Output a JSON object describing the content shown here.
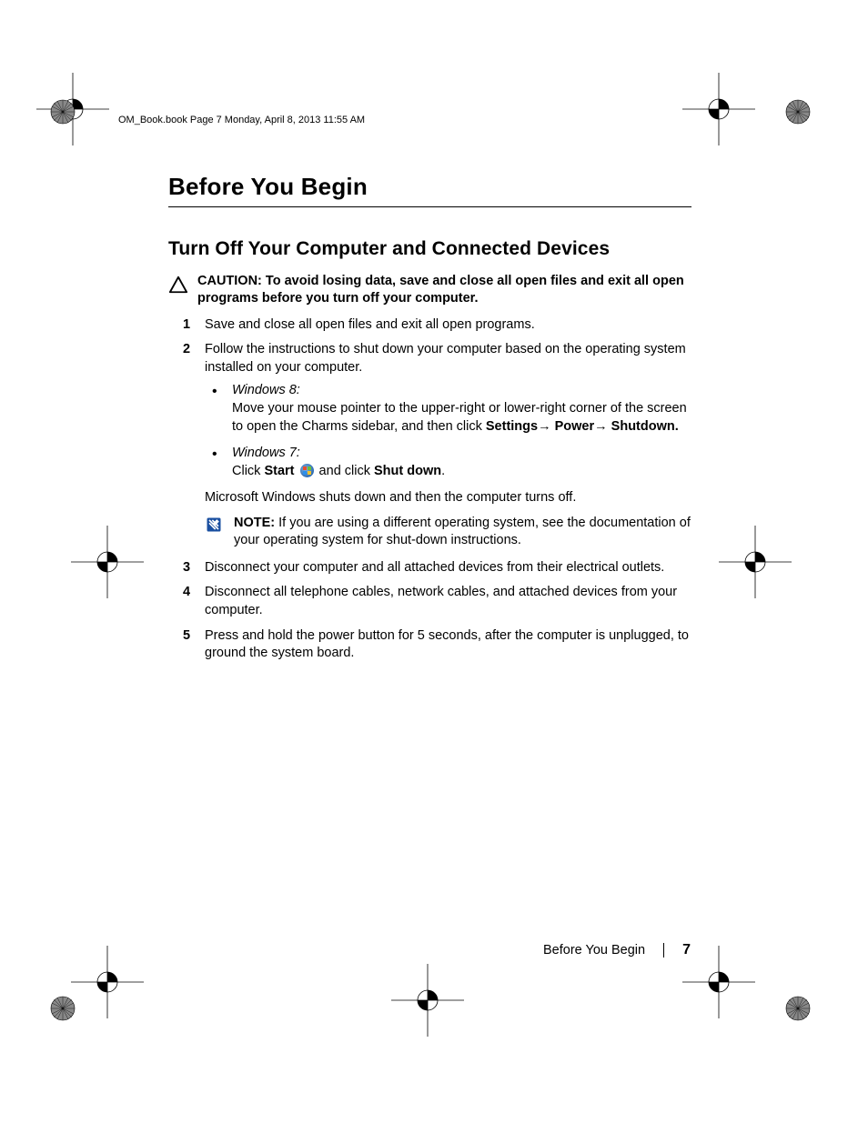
{
  "header_line": "OM_Book.book  Page 7  Monday, April 8, 2013  11:55 AM",
  "title": "Before You Begin",
  "section_heading": "Turn Off Your Computer and Connected Devices",
  "caution": {
    "label": "CAUTION:",
    "text": "To avoid losing data, save and close all open files and exit all open programs before you turn off your computer."
  },
  "steps": {
    "s1": "Save and close all open files and exit all open programs.",
    "s2": "Follow the instructions to shut down your computer based on the operating system installed on your computer.",
    "s3": "Disconnect your computer and all attached devices from their electrical outlets.",
    "s4": "Disconnect all telephone cables, network cables, and attached devices from your computer.",
    "s5": "Press and hold the power button for 5 seconds, after the computer is unplugged, to ground the system board."
  },
  "win8": {
    "label": "Windows 8:",
    "line1": "Move your mouse pointer to the upper-right or lower-right corner of the screen to open the Charms sidebar, and then click ",
    "b_settings": "Settings",
    "b_power": "Power",
    "b_shutdown": "Shutdown."
  },
  "win7": {
    "label": "Windows 7:",
    "click": "Click ",
    "start": "Start",
    "and_click": " and click ",
    "shutdown": "Shut down"
  },
  "after_bullets": "Microsoft Windows shuts down and then the computer turns off.",
  "note": {
    "label": "NOTE:",
    "text": "If you are using a different operating system, see the documentation of your operating system for shut-down instructions."
  },
  "footer": {
    "section": "Before You Begin",
    "page": "7"
  }
}
